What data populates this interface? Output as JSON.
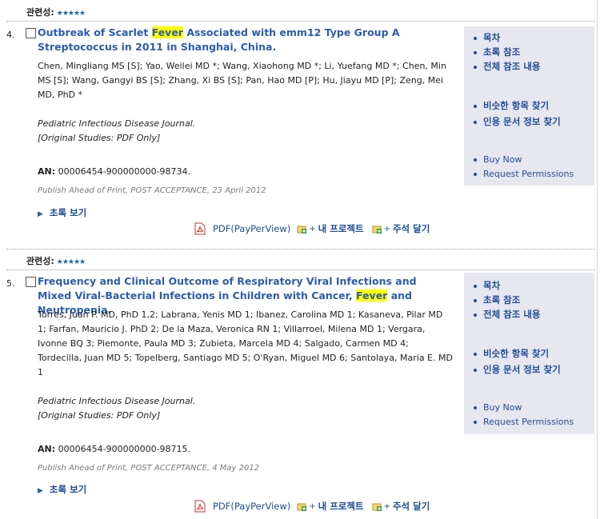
{
  "relevance_label": "관련성:",
  "relevance_stars": "★★★★★",
  "results": [
    {
      "number": "4.",
      "title_before": "Outbreak of Scarlet ",
      "title_highlight": "Fever",
      "title_after": " Associated with emm12 Type Group A Streptococcus in 2011 in Shanghai, China.",
      "authors": "Chen, Mingliang MS [S]; Yao, Weilei MD *; Wang, Xiaohong MD *; Li, Yuefang MD *; Chen, Min MS [S]; Wang, Gangyi BS [S]; Zhang, Xi BS [S]; Pan, Hao MD [P]; Hu, Jiayu MD [P]; Zeng, Mei MD, PhD *",
      "journal": "Pediatric Infectious Disease Journal.",
      "study": "[Original Studies: PDF Only]",
      "an_label": "AN:",
      "an_value": "00006454-900000000-98734.",
      "published": "Publish Ahead of Print, POST ACCEPTANCE, 23 April 2012",
      "abstract_link": "초록 보기",
      "pdf_label": "PDF(PayPerView)",
      "project_label": "내 프로젝트",
      "annotate_label": "주석 달기",
      "side_links": [
        "목차",
        "초록 참조",
        "전체 참조 내용",
        "비슷한 항목 찾기",
        "인용 문서 정보 찾기",
        "Buy Now",
        "Request Permissions"
      ]
    },
    {
      "number": "5.",
      "title_before": "Frequency and Clinical Outcome of Respiratory Viral Infections and Mixed Viral-Bacterial Infections in Children with Cancer, ",
      "title_highlight": "Fever",
      "title_after": " and Neutropenia.",
      "authors": "Torres, Juan P. MD, PhD 1,2; Labrana, Yenis MD 1; Ibanez, Carolina MD 1; Kasaneva, Pilar MD 1; Farfan, Mauricio J. PhD 2; De la Maza, Veronica RN 1; Villarroel, Milena MD 1; Vergara, Ivonne BQ 3; Piemonte, Paula MD 3; Zubieta, Marcela MD 4; Salgado, Carmen MD 4; Tordecilla, Juan MD 5; Topelberg, Santiago MD 5; O'Ryan, Miguel MD 6; Santolaya, Maria E. MD 1",
      "journal": "Pediatric Infectious Disease Journal.",
      "study": "[Original Studies: PDF Only]",
      "an_label": "AN:",
      "an_value": "00006454-900000000-98715.",
      "published": "Publish Ahead of Print, POST ACCEPTANCE, 4 May 2012",
      "abstract_link": "초록 보기",
      "pdf_label": "PDF(PayPerView)",
      "project_label": "내 프로젝트",
      "annotate_label": "주석 달기",
      "side_links": [
        "목차",
        "초록 참조",
        "전체 참조 내용",
        "비슷한 항목 찾기",
        "인용 문서 정보 찾기",
        "Buy Now",
        "Request Permissions"
      ]
    }
  ]
}
